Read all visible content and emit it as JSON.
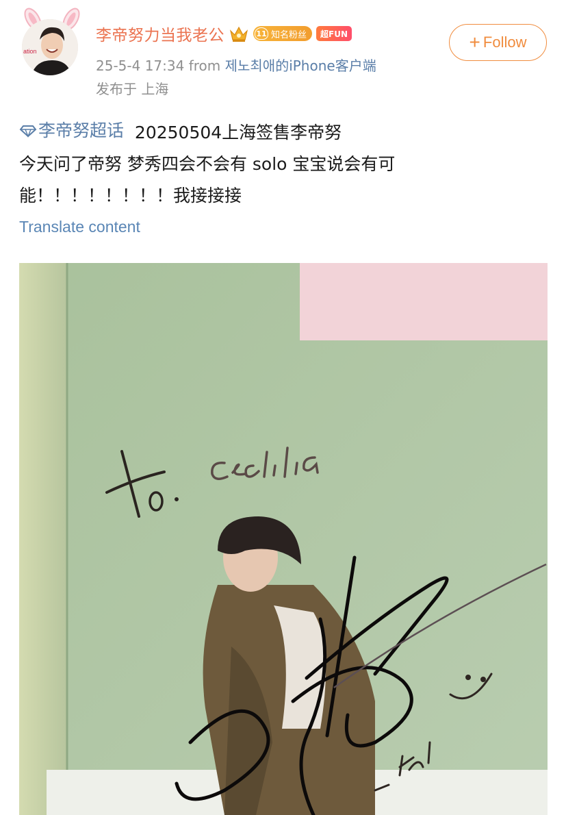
{
  "post": {
    "author": {
      "name": "李帝努力当我老公",
      "fan_badge_level": "11",
      "fan_badge_label": "知名粉丝",
      "fun_badge_label": "超FUN",
      "crown_icon": "crown-icon",
      "avatar_icon": "avatar-photo"
    },
    "time": "25-5-4 17:34",
    "from_label": "from",
    "source": "제노최애的iPhone客户端",
    "location": "发布于 上海",
    "follow_label": "Follow",
    "follow_icon": "+",
    "topic": "李帝努超话",
    "text_line1_rest": "20250504上海签售李帝努",
    "text_line2": "今天问了帝努 梦秀四会不会有 solo 宝宝说会有可",
    "text_line3": "能！！！！！！！！我接接接",
    "translate_label": "Translate content"
  },
  "photo": {
    "handwriting_to": "to.",
    "handwriting_name": "Cecilia",
    "signature_extra": "- Jeno",
    "smiley": ":)"
  },
  "colors": {
    "username": "#eb7350",
    "link": "#5a7ea8",
    "follow": "#f08c3e",
    "meta": "#8f8f8f"
  }
}
